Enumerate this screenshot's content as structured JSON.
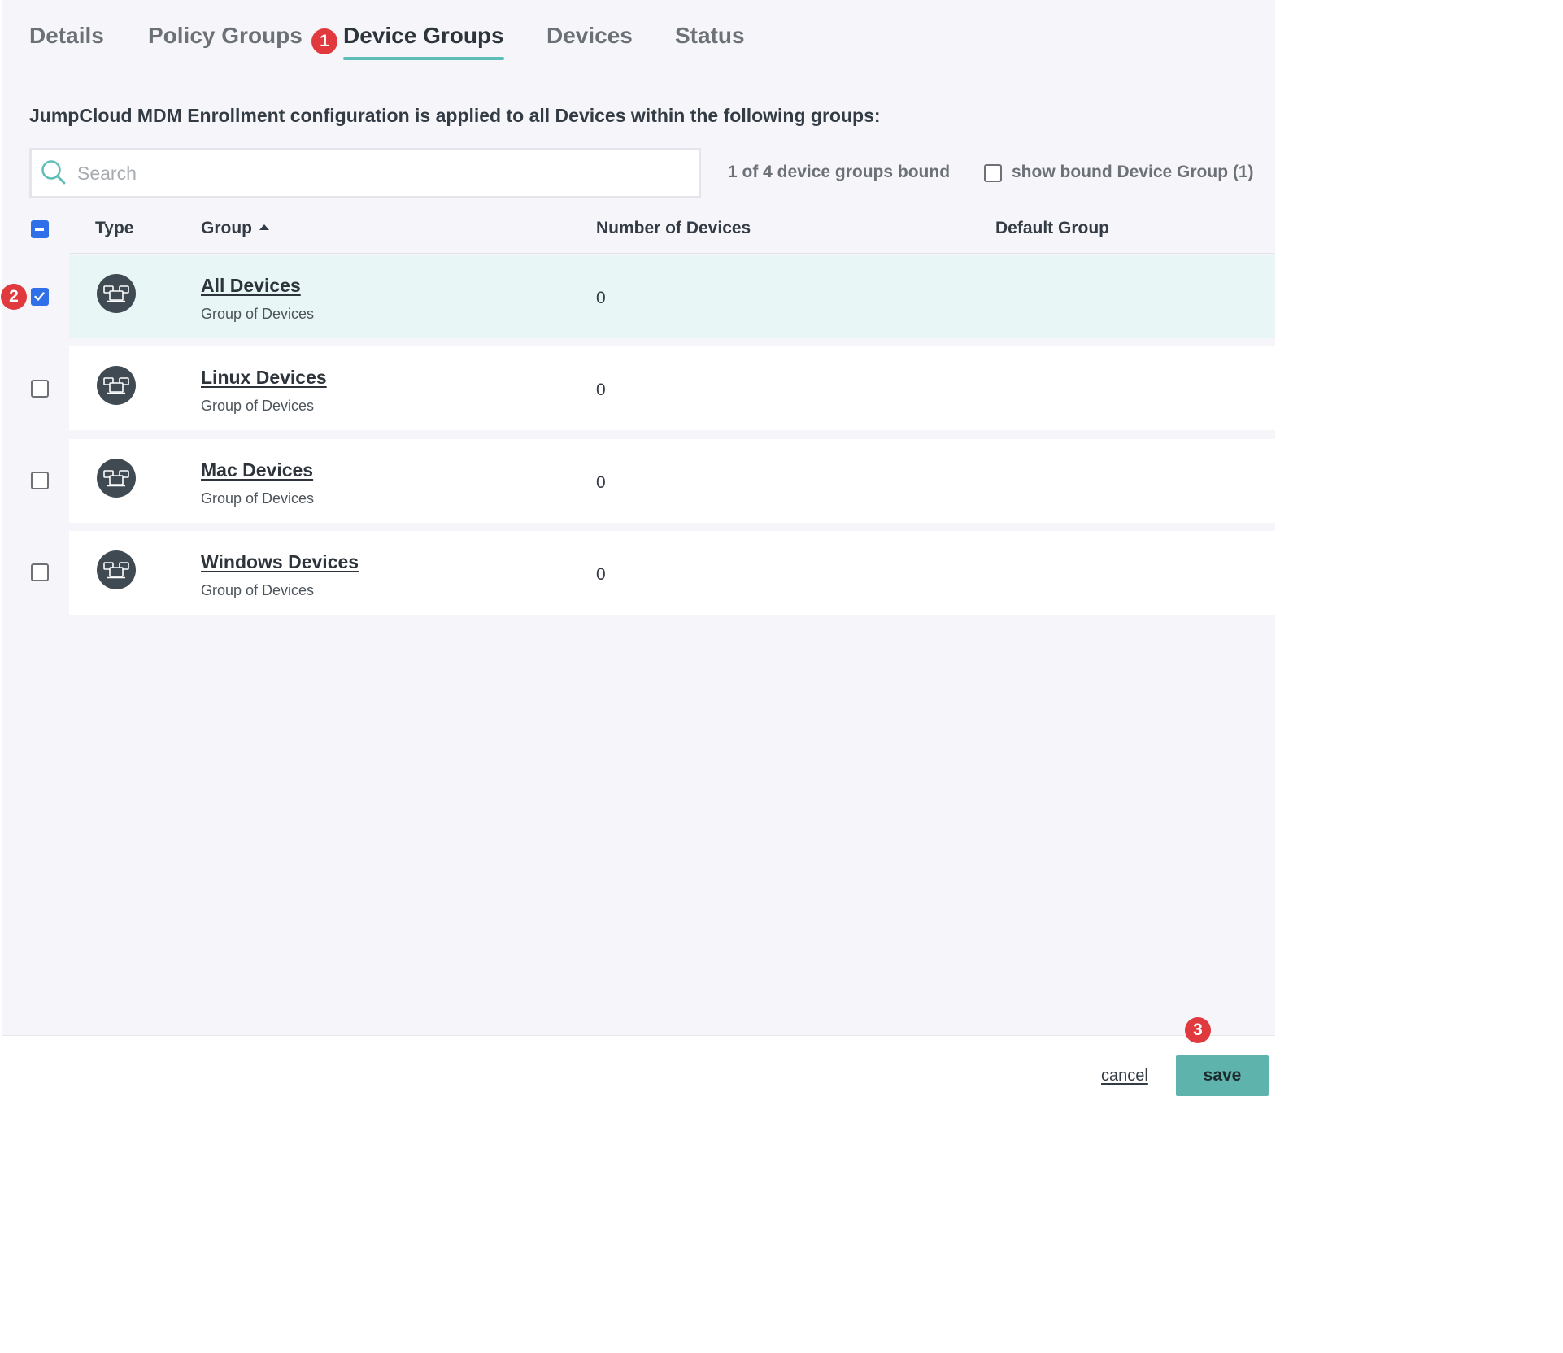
{
  "tabs": [
    {
      "label": "Details"
    },
    {
      "label": "Policy Groups"
    },
    {
      "label": "Device Groups",
      "active": true
    },
    {
      "label": "Devices"
    },
    {
      "label": "Status"
    }
  ],
  "annotations": [
    "1",
    "2",
    "3"
  ],
  "description": "JumpCloud MDM Enrollment configuration is applied to all Devices within the following groups:",
  "search": {
    "placeholder": "Search",
    "value": ""
  },
  "bound_count": "1 of 4 device groups bound",
  "show_bound": {
    "label": "show bound Device Group (1)",
    "checked": false
  },
  "table": {
    "headers": {
      "type": "Type",
      "group": "Group",
      "devices": "Number of Devices",
      "default": "Default Group"
    },
    "rows": [
      {
        "name": "All Devices",
        "sub": "Group of Devices",
        "count": "0",
        "checked": true
      },
      {
        "name": "Linux Devices",
        "sub": "Group of Devices",
        "count": "0",
        "checked": false
      },
      {
        "name": "Mac Devices",
        "sub": "Group of Devices",
        "count": "0",
        "checked": false
      },
      {
        "name": "Windows Devices",
        "sub": "Group of Devices",
        "count": "0",
        "checked": false
      }
    ]
  },
  "footer": {
    "cancel_label": "cancel",
    "save_label": "save"
  },
  "colors": {
    "accent": "#5fbdb8",
    "checkbox": "#2f6fe8",
    "badge": "#e0393e",
    "selected_row": "#e8f6f5"
  },
  "icons": {
    "search": "search-icon",
    "group": "device-group-icon",
    "sort": "sort-ascending-icon",
    "check": "checkmark-icon"
  }
}
